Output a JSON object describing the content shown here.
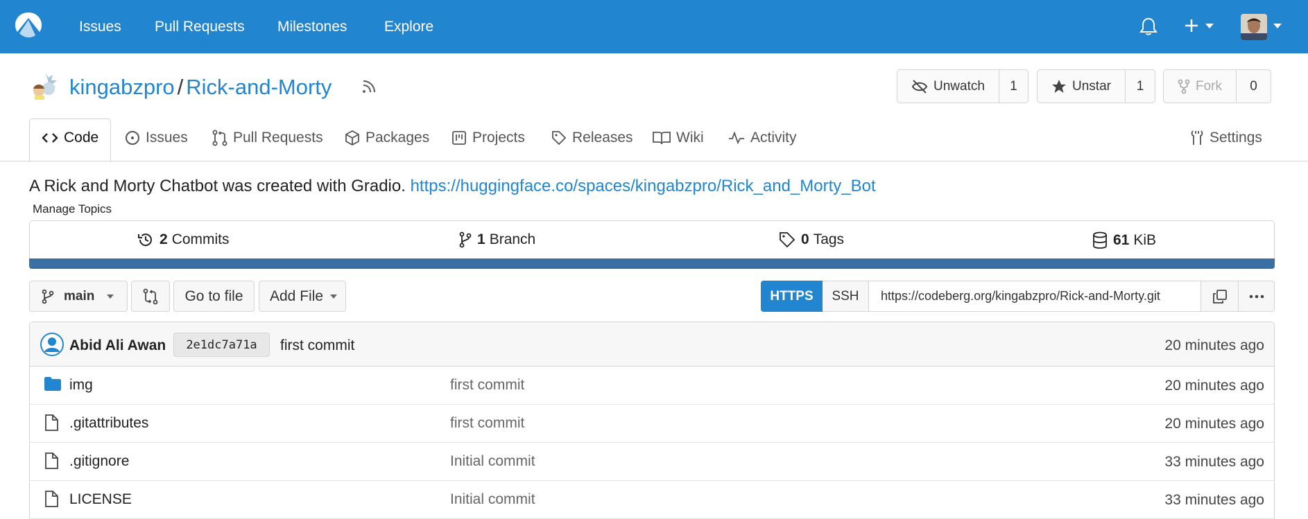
{
  "nav": {
    "items": [
      "Issues",
      "Pull Requests",
      "Milestones",
      "Explore"
    ]
  },
  "repo": {
    "owner": "kingabzpro",
    "separator": "/",
    "name": "Rick-and-Morty",
    "watch": {
      "label": "Unwatch",
      "count": "1"
    },
    "star": {
      "label": "Unstar",
      "count": "1"
    },
    "fork": {
      "label": "Fork",
      "count": "0"
    }
  },
  "tabs": {
    "code": "Code",
    "issues": "Issues",
    "pulls": "Pull Requests",
    "packages": "Packages",
    "projects": "Projects",
    "releases": "Releases",
    "wiki": "Wiki",
    "activity": "Activity",
    "settings": "Settings"
  },
  "description": {
    "text": "A Rick and Morty Chatbot was created with Gradio.",
    "link": "https://huggingface.co/spaces/kingabzpro/Rick_and_Morty_Bot",
    "manage_topics": "Manage Topics"
  },
  "stats": {
    "commits": {
      "count": "2",
      "label": "Commits"
    },
    "branches": {
      "count": "1",
      "label": "Branch"
    },
    "tags": {
      "count": "0",
      "label": "Tags"
    },
    "size": {
      "count": "61",
      "label": "KiB"
    }
  },
  "toolbar": {
    "branch": "main",
    "go_to_file": "Go to file",
    "add_file": "Add File",
    "https": "HTTPS",
    "ssh": "SSH",
    "clone_url": "https://codeberg.org/kingabzpro/Rick-and-Morty.git"
  },
  "latest_commit": {
    "author": "Abid Ali Awan",
    "sha": "2e1dc7a71a",
    "message": "first commit",
    "time": "20 minutes ago"
  },
  "files": [
    {
      "name": "img",
      "type": "folder",
      "message": "first commit",
      "time": "20 minutes ago"
    },
    {
      "name": ".gitattributes",
      "type": "file",
      "message": "first commit",
      "time": "20 minutes ago"
    },
    {
      "name": ".gitignore",
      "type": "file",
      "message": "Initial commit",
      "time": "33 minutes ago"
    },
    {
      "name": "LICENSE",
      "type": "file",
      "message": "Initial commit",
      "time": "33 minutes ago"
    }
  ],
  "colors": {
    "primary": "#2185d0",
    "stats_bar": "#3a6fa3"
  }
}
